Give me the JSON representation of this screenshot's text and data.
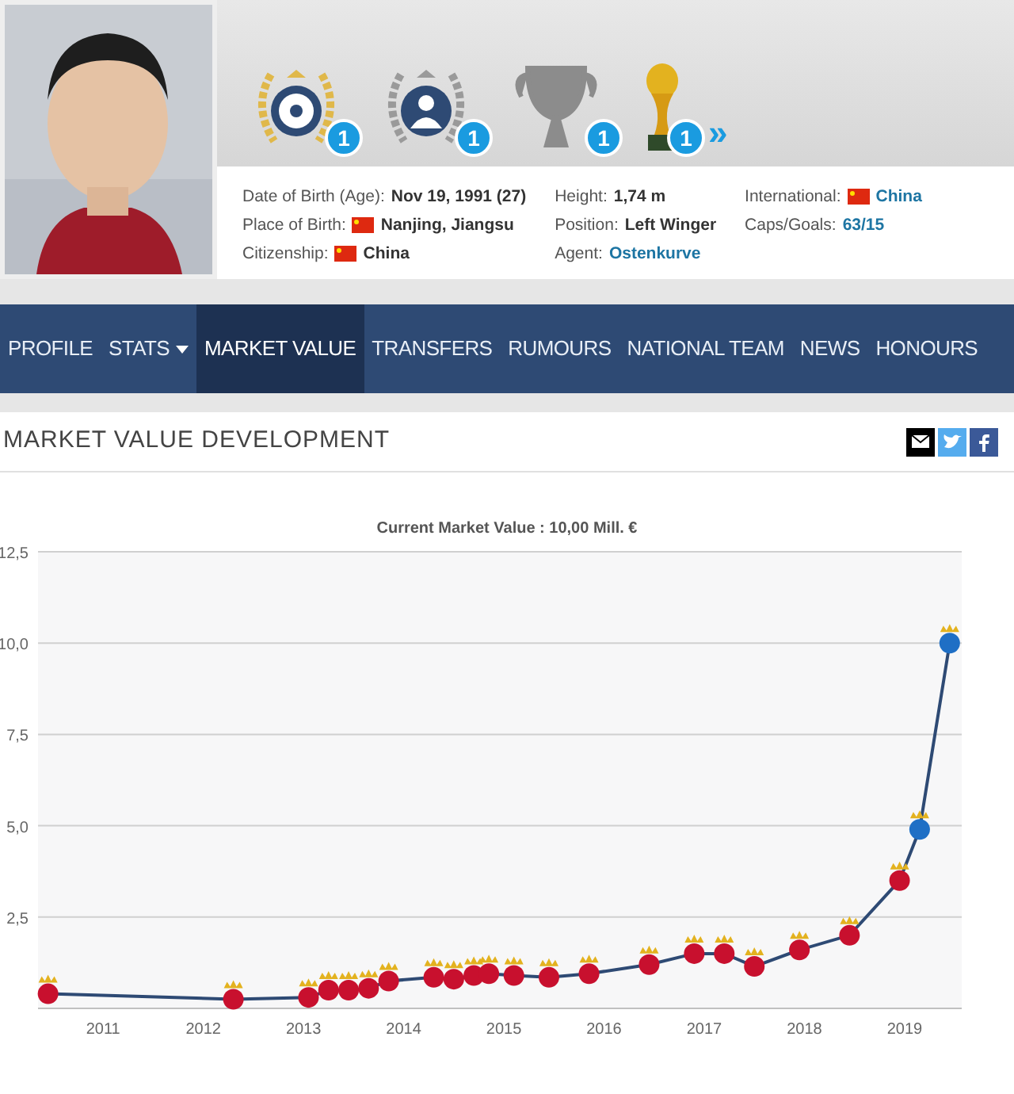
{
  "header": {
    "photo": {
      "kind": "picture"
    },
    "awards": [
      {
        "kind": "laurel-ball",
        "count": "1"
      },
      {
        "kind": "laurel-person",
        "count": "1"
      },
      {
        "kind": "cup",
        "count": "1"
      },
      {
        "kind": "golden-trophy",
        "count": "1"
      }
    ],
    "more": "»",
    "info": [
      [
        {
          "label": "Date of Birth (Age):",
          "value": "Nov 19, 1991 (27)",
          "link": false,
          "flag": false
        },
        {
          "label": "Place of Birth:",
          "value": "Nanjing, Jiangsu",
          "link": false,
          "flag": true
        },
        {
          "label": "Citizenship:",
          "value": "China",
          "link": false,
          "flag": true
        }
      ],
      [
        {
          "label": "Height:",
          "value": "1,74 m",
          "link": false,
          "flag": false
        },
        {
          "label": "Position:",
          "value": "Left Winger",
          "link": false,
          "flag": false
        },
        {
          "label": "Agent:",
          "value": "Ostenkurve",
          "link": true,
          "flag": false
        }
      ],
      [
        {
          "label": "International:",
          "value": "China",
          "link": true,
          "flag": true
        },
        {
          "label": "Caps/Goals:",
          "value": "63/15",
          "link": true,
          "flag": false
        }
      ]
    ]
  },
  "nav": [
    {
      "label": "PROFILE",
      "selected": false,
      "dropdown": false
    },
    {
      "label": "STATS",
      "selected": false,
      "dropdown": true
    },
    {
      "label": "MARKET VALUE",
      "selected": true,
      "dropdown": false
    },
    {
      "label": "TRANSFERS",
      "selected": false,
      "dropdown": false
    },
    {
      "label": "RUMOURS",
      "selected": false,
      "dropdown": false
    },
    {
      "label": "NATIONAL TEAM",
      "selected": false,
      "dropdown": false
    },
    {
      "label": "NEWS",
      "selected": false,
      "dropdown": false
    },
    {
      "label": "HONOURS",
      "selected": false,
      "dropdown": false
    }
  ],
  "card": {
    "title": "MARKET VALUE DEVELOPMENT",
    "share": [
      {
        "kind": "email"
      },
      {
        "kind": "twitter"
      },
      {
        "kind": "facebook"
      }
    ],
    "markers": [
      {
        "color": "#c8102e"
      },
      {
        "color": "#c8102e"
      },
      {
        "color": "#c8102e"
      },
      {
        "color": "#c8102e"
      },
      {
        "color": "#c8102e"
      },
      {
        "color": "#c8102e"
      },
      {
        "color": "#c8102e"
      },
      {
        "color": "#c8102e"
      },
      {
        "color": "#c8102e"
      },
      {
        "color": "#c8102e"
      },
      {
        "color": "#c8102e"
      },
      {
        "color": "#c8102e"
      },
      {
        "color": "#c8102e"
      },
      {
        "color": "#c8102e"
      },
      {
        "color": "#c8102e"
      },
      {
        "color": "#c8102e"
      },
      {
        "color": "#c8102e"
      },
      {
        "color": "#c8102e"
      },
      {
        "color": "#c8102e"
      },
      {
        "color": "#c8102e"
      },
      {
        "color": "#c8102e"
      },
      {
        "color": "#1f6fc5"
      },
      {
        "color": "#1f6fc5"
      }
    ],
    "chart_data": {
      "type": "line",
      "title": "Current Market Value : 10,00 Mill. €",
      "x": [
        2010.45,
        2012.3,
        2013.05,
        2013.25,
        2013.45,
        2013.65,
        2013.85,
        2014.3,
        2014.5,
        2014.7,
        2014.85,
        2015.1,
        2015.45,
        2015.85,
        2016.45,
        2016.9,
        2017.2,
        2017.5,
        2017.95,
        2018.45,
        2018.95,
        2019.15,
        2019.45
      ],
      "series": [
        {
          "color": "#2e4a74",
          "marker": true,
          "values": [
            0.4,
            0.25,
            0.3,
            0.5,
            0.5,
            0.55,
            0.75,
            0.85,
            0.8,
            0.9,
            0.95,
            0.9,
            0.85,
            0.95,
            1.2,
            1.5,
            1.5,
            1.15,
            1.6,
            2.0,
            3.5,
            4.9,
            10.0
          ]
        }
      ],
      "grid": true,
      "xlim": [
        2010.35,
        2019.57
      ],
      "ylim": [
        0,
        12.5
      ],
      "xticks": [
        2011,
        2012,
        2013,
        2014,
        2015,
        2016,
        2017,
        2018,
        2019
      ],
      "yticks": [
        {
          "value": 2.5,
          "label": "2,5"
        },
        {
          "value": 5,
          "label": "5,0"
        },
        {
          "value": 7.5,
          "label": "7,5"
        },
        {
          "value": 10,
          "label": "10,0"
        },
        {
          "value": 12.5,
          "label": "12,5"
        }
      ]
    }
  }
}
